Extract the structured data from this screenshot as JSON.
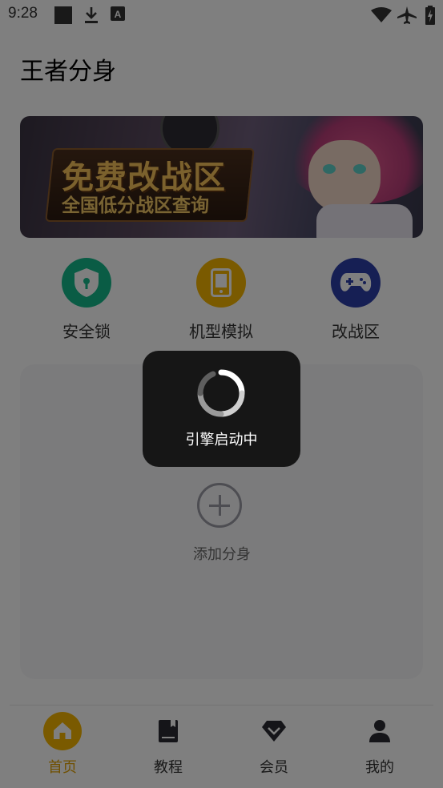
{
  "status_bar": {
    "time": "9:28",
    "left_icons": [
      "stop-square-icon",
      "download-icon",
      "font-a-icon"
    ],
    "right_icons": [
      "wifi-icon",
      "airplane-icon",
      "battery-charging-icon"
    ]
  },
  "header": {
    "title": "王者分身"
  },
  "banner": {
    "line1": "免费改战区",
    "line2": "全国低分战区查询"
  },
  "features": [
    {
      "label": "安全锁",
      "icon": "shield-lock-icon",
      "color": "#15b98a"
    },
    {
      "label": "机型模拟",
      "icon": "phone-icon",
      "color": "#f5b400"
    },
    {
      "label": "改战区",
      "icon": "gamepad-icon",
      "color": "#2d3ea8"
    }
  ],
  "add_clone": {
    "label": "添加分身"
  },
  "tabs": [
    {
      "label": "首页",
      "icon": "home-icon",
      "active": true
    },
    {
      "label": "教程",
      "icon": "book-icon",
      "active": false
    },
    {
      "label": "会员",
      "icon": "diamond-icon",
      "active": false
    },
    {
      "label": "我的",
      "icon": "person-icon",
      "active": false
    }
  ],
  "loading": {
    "text": "引擎启动中"
  },
  "colors": {
    "accent": "#f5b400",
    "active_tab_text": "#e0a100",
    "overlay": "rgba(0,0,0,0.5)",
    "dialog_bg": "#161616"
  }
}
